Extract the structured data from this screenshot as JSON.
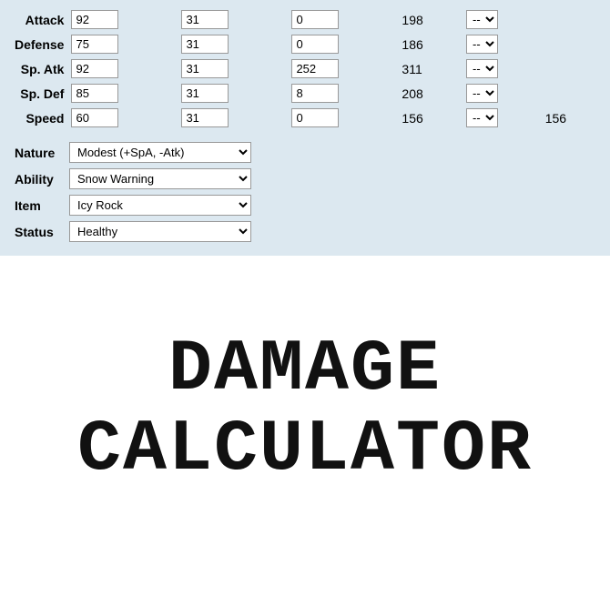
{
  "stats": {
    "rows": [
      {
        "label": "Attack",
        "base": "92",
        "iv": "31",
        "ev": "0",
        "total": "198",
        "modifier": "--",
        "final": ""
      },
      {
        "label": "Defense",
        "base": "75",
        "iv": "31",
        "ev": "0",
        "total": "186",
        "modifier": "--",
        "final": ""
      },
      {
        "label": "Sp. Atk",
        "base": "92",
        "iv": "31",
        "ev": "252",
        "total": "311",
        "modifier": "--",
        "final": ""
      },
      {
        "label": "Sp. Def",
        "base": "85",
        "iv": "31",
        "ev": "8",
        "total": "208",
        "modifier": "--",
        "final": ""
      },
      {
        "label": "Speed",
        "base": "60",
        "iv": "31",
        "ev": "0",
        "total": "156",
        "modifier": "--",
        "final": "156"
      }
    ]
  },
  "attributes": {
    "nature_label": "Nature",
    "nature_value": "Modest (+SpA, -Atk)",
    "ability_label": "Ability",
    "ability_value": "Snow Warning",
    "item_label": "Item",
    "item_value": "Icy Rock",
    "status_label": "Status",
    "status_value": "Healthy"
  },
  "title_line1": "DAMAGE",
  "title_line2": "CALCULATOR"
}
